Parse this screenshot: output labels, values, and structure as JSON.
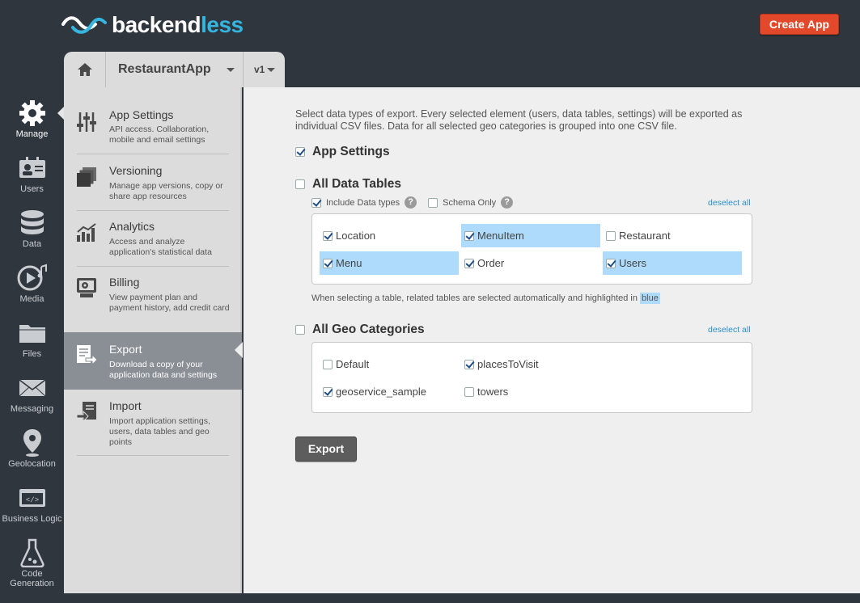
{
  "header": {
    "logo_text_1": "backend",
    "logo_text_2": "less",
    "create_app_label": "Create App"
  },
  "appbar": {
    "app_name": "RestaurantApp",
    "version": "v1"
  },
  "iconbar": {
    "items": [
      {
        "label": "Manage",
        "icon": "gear-icon"
      },
      {
        "label": "Users",
        "icon": "users-icon"
      },
      {
        "label": "Data",
        "icon": "database-icon"
      },
      {
        "label": "Media",
        "icon": "media-icon"
      },
      {
        "label": "Files",
        "icon": "folder-icon"
      },
      {
        "label": "Messaging",
        "icon": "envelope-icon"
      },
      {
        "label": "Geolocation",
        "icon": "pin-icon"
      },
      {
        "label": "Business Logic",
        "icon": "code-icon"
      },
      {
        "label": "Code Generation",
        "icon": "flask-icon"
      }
    ]
  },
  "sidebar": {
    "items": [
      {
        "title": "App Settings",
        "desc": "API access. Collaboration, mobile and email settings",
        "icon": "sliders-icon"
      },
      {
        "title": "Versioning",
        "desc": "Manage app versions, copy or share app resources",
        "icon": "layers-icon"
      },
      {
        "title": "Analytics",
        "desc": "Access and analyze application's statistical data",
        "icon": "bar-chart-icon"
      },
      {
        "title": "Billing",
        "desc": "View payment plan and payment history, add credit card",
        "icon": "billing-icon"
      },
      {
        "title": "Export",
        "desc": "Download a copy of your application data and settings",
        "icon": "export-icon"
      },
      {
        "title": "Import",
        "desc": "Import application settings, users, data tables and geo points",
        "icon": "import-icon"
      }
    ]
  },
  "main": {
    "intro": "Select data types of export. Every selected element (users, data tables, settings) will be exported as individual CSV files. Data for all selected geo categories is grouped into one CSV file.",
    "app_settings_label": "App Settings",
    "data_tables_label": "All Data Tables",
    "include_types_label": "Include Data types",
    "schema_only_label": "Schema Only",
    "deselect_label": "deselect all",
    "tables": [
      {
        "name": "Location",
        "checked": true,
        "highlight": false
      },
      {
        "name": "MenuItem",
        "checked": true,
        "highlight": true
      },
      {
        "name": "Restaurant",
        "checked": false,
        "highlight": false
      },
      {
        "name": "Menu",
        "checked": true,
        "highlight": true
      },
      {
        "name": "Order",
        "checked": true,
        "highlight": false
      },
      {
        "name": "Users",
        "checked": true,
        "highlight": true
      }
    ],
    "note": "When selecting a table, related tables are selected automatically and highlighted in",
    "note_blue": "blue",
    "geo_label": "All Geo Categories",
    "geo_deselect_label": "deselect all",
    "geo": [
      {
        "name": "Default",
        "checked": false
      },
      {
        "name": "placesToVisit",
        "checked": true
      },
      {
        "name": "geoservice_sample",
        "checked": true
      },
      {
        "name": "towers",
        "checked": false
      }
    ],
    "export_label": "Export"
  },
  "colors": {
    "accent": "#35b6e0",
    "create_button": "#e2492b",
    "highlight": "#aedbfb",
    "link": "#2a8fcc"
  }
}
